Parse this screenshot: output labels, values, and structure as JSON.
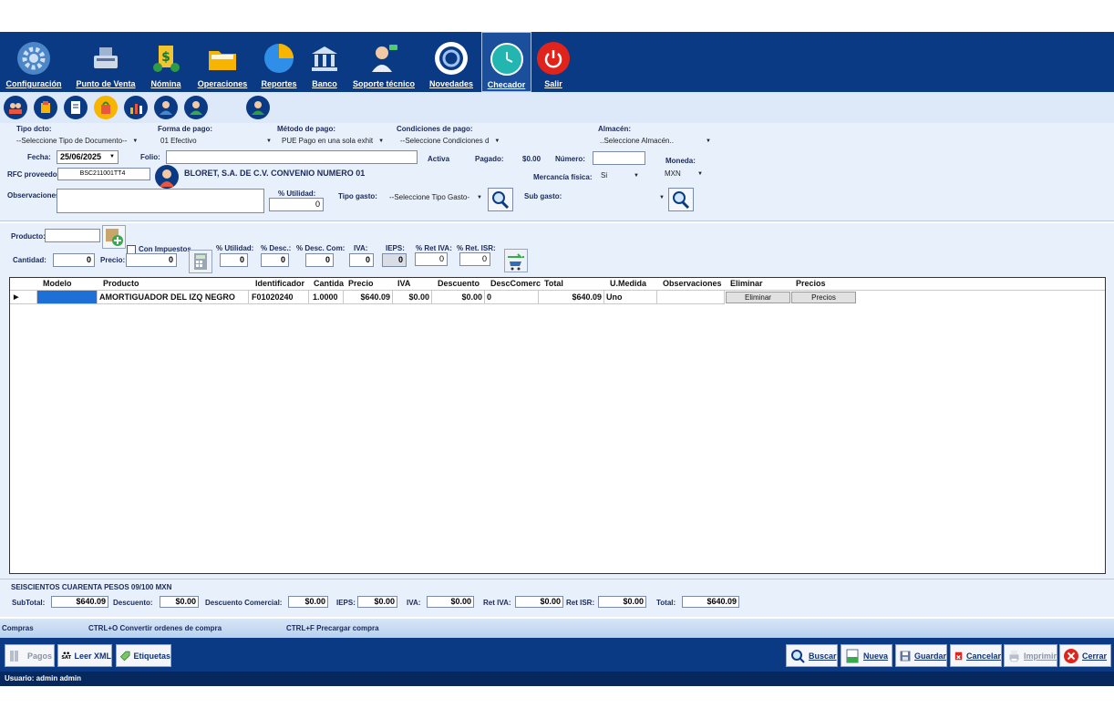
{
  "toolbar": {
    "items": [
      {
        "label": "Configuración",
        "icon": "gear-icon"
      },
      {
        "label": "Punto de Venta",
        "icon": "cash-register-icon"
      },
      {
        "label": "Nómina",
        "icon": "payroll-icon"
      },
      {
        "label": "Operaciones",
        "icon": "folder-icon"
      },
      {
        "label": "Reportes",
        "icon": "pie-chart-icon"
      },
      {
        "label": "Banco",
        "icon": "bank-icon"
      },
      {
        "label": "Soporte técnico",
        "icon": "support-agent-icon"
      },
      {
        "label": "Novedades",
        "icon": "news-icon"
      },
      {
        "label": "Checador",
        "icon": "clock-icon"
      },
      {
        "label": "Salir",
        "icon": "power-icon"
      }
    ]
  },
  "form": {
    "tipo_dcto_label": "Tipo dcto:",
    "tipo_dcto_value": "--Seleccione Tipo de Documento--",
    "forma_pago_label": "Forma de pago:",
    "forma_pago_value": "01 Efectivo",
    "metodo_pago_label": "Método de pago:",
    "metodo_pago_value": "PUE Pago en una sola exhit",
    "condiciones_label": "Condiciones de pago:",
    "condiciones_value": "--Seleccione Condiciones d",
    "almacen_label": "Almacén:",
    "almacen_value": "..Seleccione Almacén..",
    "fecha_label": "Fecha:",
    "fecha_value": "25/06/2025",
    "folio_label": "Folio:",
    "folio_value": "",
    "activa": "Activa",
    "pagado_label": "Pagado:",
    "pagado_value": "$0.00",
    "numero_label": "Número:",
    "numero_value": "",
    "moneda_label": "Moneda:",
    "moneda_value": "MXN",
    "rfc_label": "RFC proveedor:",
    "rfc_value": "BSC211001TT4",
    "proveedor_name": "BLORET, S.A. DE C.V. CONVENIO NUMERO 01",
    "mercancia_label": "Mercancía física:",
    "mercancia_value": "Si",
    "observaciones_label": "Observaciones:",
    "utilidad_label": "% Utilidad:",
    "utilidad_value": "0",
    "tipo_gasto_label": "Tipo gasto:",
    "tipo_gasto_value": "--Seleccione Tipo Gasto-",
    "sub_gasto_label": "Sub gasto:",
    "sub_gasto_value": ""
  },
  "product_entry": {
    "producto_label": "Producto:",
    "con_impuestos_label": "Con Impuestos",
    "cantidad_label": "Cantidad:",
    "cantidad_value": "0",
    "precio_label": "Precio:",
    "precio_value": "0",
    "utilidad_label": "% Utilidad:",
    "utilidad_value": "0",
    "desc_label": "% Desc.:",
    "desc_value": "0",
    "desc_com_label": "% Desc. Com:",
    "desc_com_value": "0",
    "iva_label": "IVA:",
    "iva_value": "0",
    "ieps_label": "IEPS:",
    "ieps_value": "0",
    "ret_iva_label": "% Ret IVA:",
    "ret_iva_value": "0",
    "ret_isr_label": "% Ret. ISR:",
    "ret_isr_value": "0"
  },
  "grid": {
    "columns": [
      "Modelo",
      "Producto",
      "Identificador",
      "Cantida",
      "Precio",
      "IVA",
      "Descuento",
      "DescComerc",
      "Total",
      "U.Medida",
      "Observaciones",
      "Eliminar",
      "Precios"
    ],
    "rows": [
      {
        "modelo": "",
        "producto": "AMORTIGUADOR DEL IZQ NEGRO",
        "identificador": "F01020240",
        "cantidad": "1.0000",
        "precio": "$640.09",
        "iva": "$0.00",
        "descuento": "$0.00",
        "desc_comerc": "0",
        "total": "$640.09",
        "umedida": "Uno",
        "observaciones": "",
        "eliminar": "Eliminar",
        "precios": "Precios"
      }
    ]
  },
  "totals": {
    "amount_words": "SEISCIENTOS CUARENTA PESOS  09/100 MXN",
    "subtotal_label": "SubTotal:",
    "subtotal_value": "$640.09",
    "descuento_label": "Descuento:",
    "descuento_value": "$0.00",
    "desc_comercial_label": "Descuento Comercial:",
    "desc_comercial_value": "$0.00",
    "ieps_label": "IEPS:",
    "ieps_value": "$0.00",
    "iva_label": "IVA:",
    "iva_value": "$0.00",
    "ret_iva_label": "Ret IVA:",
    "ret_iva_value": "$0.00",
    "ret_isr_label": "Ret ISR:",
    "ret_isr_value": "$0.00",
    "total_label": "Total:",
    "total_value": "$640.09"
  },
  "hints": {
    "section": "Compras",
    "hint1": "CTRL+O Convertir ordenes de compra",
    "hint2": "CTRL+F Precargar compra"
  },
  "bottom": {
    "pagos": "Pagos",
    "leer_xml": "Leer XML",
    "etiquetas": "Etiquetas",
    "buscar": "Buscar",
    "nueva": "Nueva",
    "guardar": "Guardar",
    "cancelar": "Cancelar",
    "imprimir": "Imprimir",
    "cerrar": "Cerrar"
  },
  "status": {
    "user": "Usuario: admin admin"
  }
}
